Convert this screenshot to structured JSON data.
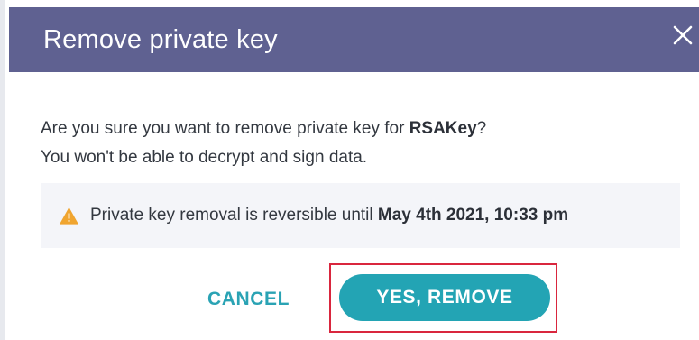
{
  "dialog": {
    "title": "Remove private key",
    "close_icon": "close-icon",
    "message_part1": "Are you sure you want to remove private key for ",
    "key_name": "RSAKey",
    "message_part2": "?",
    "message_line2": "You won't be able to decrypt and sign data.",
    "notice": {
      "icon": "warning-icon",
      "text": "Private key removal is reversible until ",
      "date": "May 4th 2021, 10:33 pm"
    },
    "buttons": {
      "cancel_label": "CANCEL",
      "confirm_label": "YES, REMOVE"
    }
  },
  "colors": {
    "header": "#5f6191",
    "accent": "#23a4b4",
    "warning": "#f0a530",
    "highlight": "#d9263e"
  }
}
